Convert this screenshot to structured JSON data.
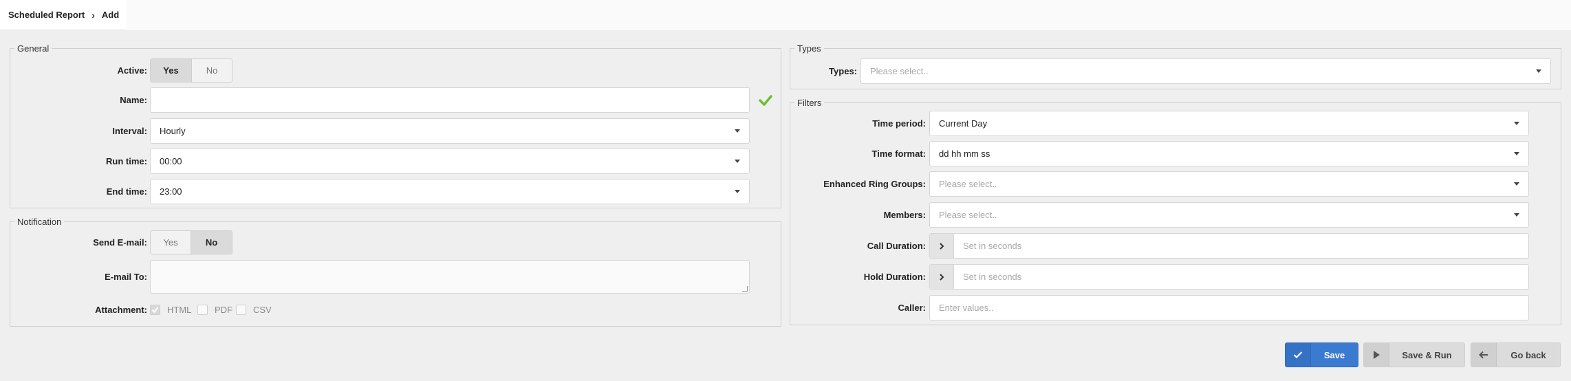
{
  "breadcrumb": {
    "parent": "Scheduled Report",
    "current": "Add"
  },
  "general": {
    "legend": "General",
    "active": {
      "label": "Active:",
      "yes": "Yes",
      "no": "No",
      "selected": "Yes"
    },
    "name": {
      "label": "Name:",
      "value": ""
    },
    "interval": {
      "label": "Interval:",
      "value": "Hourly"
    },
    "run_time": {
      "label": "Run time:",
      "value": "00:00"
    },
    "end_time": {
      "label": "End time:",
      "value": "23:00"
    }
  },
  "notification": {
    "legend": "Notification",
    "send_email": {
      "label": "Send E-mail:",
      "yes": "Yes",
      "no": "No",
      "selected": "No"
    },
    "email_to": {
      "label": "E-mail To:",
      "value": ""
    },
    "attachment": {
      "label": "Attachment:",
      "options": [
        {
          "label": "HTML",
          "checked": true
        },
        {
          "label": "PDF",
          "checked": false
        },
        {
          "label": "CSV",
          "checked": false
        }
      ]
    }
  },
  "types": {
    "legend": "Types",
    "types": {
      "label": "Types:",
      "placeholder": "Please select.."
    }
  },
  "filters": {
    "legend": "Filters",
    "time_period": {
      "label": "Time period:",
      "value": "Current Day"
    },
    "time_format": {
      "label": "Time format:",
      "value": "dd hh mm ss"
    },
    "ring_groups": {
      "label": "Enhanced Ring Groups:",
      "placeholder": "Please select.."
    },
    "members": {
      "label": "Members:",
      "placeholder": "Please select.."
    },
    "call_duration": {
      "label": "Call Duration:",
      "placeholder": "Set in seconds"
    },
    "hold_duration": {
      "label": "Hold Duration:",
      "placeholder": "Set in seconds"
    },
    "caller": {
      "label": "Caller:",
      "placeholder": "Enter values.."
    }
  },
  "actions": {
    "save": "Save",
    "save_run": "Save & Run",
    "go_back": "Go back"
  },
  "colors": {
    "primary": "#3a7ad0",
    "valid": "#6cbd2e"
  },
  "icons": [
    "chevron-right-icon",
    "checkmark-icon",
    "caret-down-icon",
    "play-icon",
    "arrow-left-icon"
  ]
}
